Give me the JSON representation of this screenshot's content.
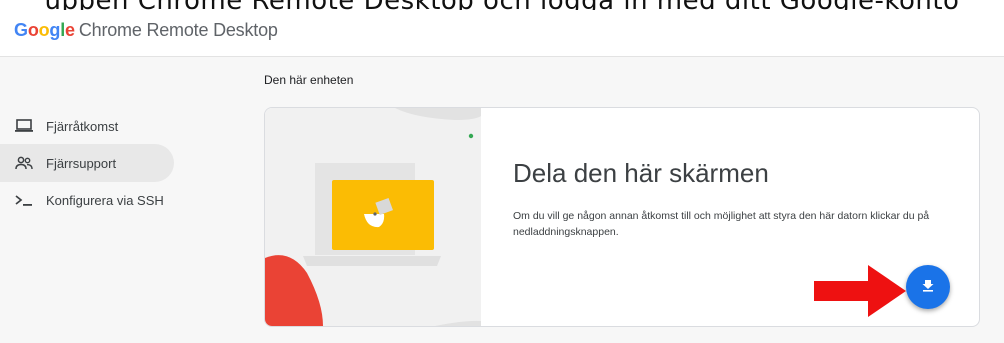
{
  "top_caption": "uppen Chrome Remote Desktop och logga in med ditt Google-konto",
  "header": {
    "logo_google": "Google",
    "product_name": "Chrome Remote Desktop",
    "google_colors": [
      "#4285F4",
      "#EA4335",
      "#FBBC05",
      "#4285F4",
      "#34A853",
      "#EA4335"
    ]
  },
  "sidebar": {
    "items": [
      {
        "label": "Fjärråtkomst",
        "icon": "laptop-icon",
        "active": false
      },
      {
        "label": "Fjärrsupport",
        "icon": "people-icon",
        "active": true
      },
      {
        "label": "Konfigurera via SSH",
        "icon": "terminal-icon",
        "active": false
      }
    ]
  },
  "main": {
    "section_label": "Den här enheten",
    "card": {
      "title": "Dela den här skärmen",
      "description": "Om du vill ge någon annan åtkomst till och möjlighet att styra den här datorn klickar du på nedladdningsknappen.",
      "download_button_icon": "download-icon"
    }
  },
  "annotation": {
    "arrow_icon": "red-arrow-icon",
    "arrow_color": "#ee1111"
  },
  "colors": {
    "accent": "#1a73e8",
    "illustration_yellow": "#fbbc04",
    "illustration_red": "#ea4335",
    "illustration_green": "#34a853"
  }
}
